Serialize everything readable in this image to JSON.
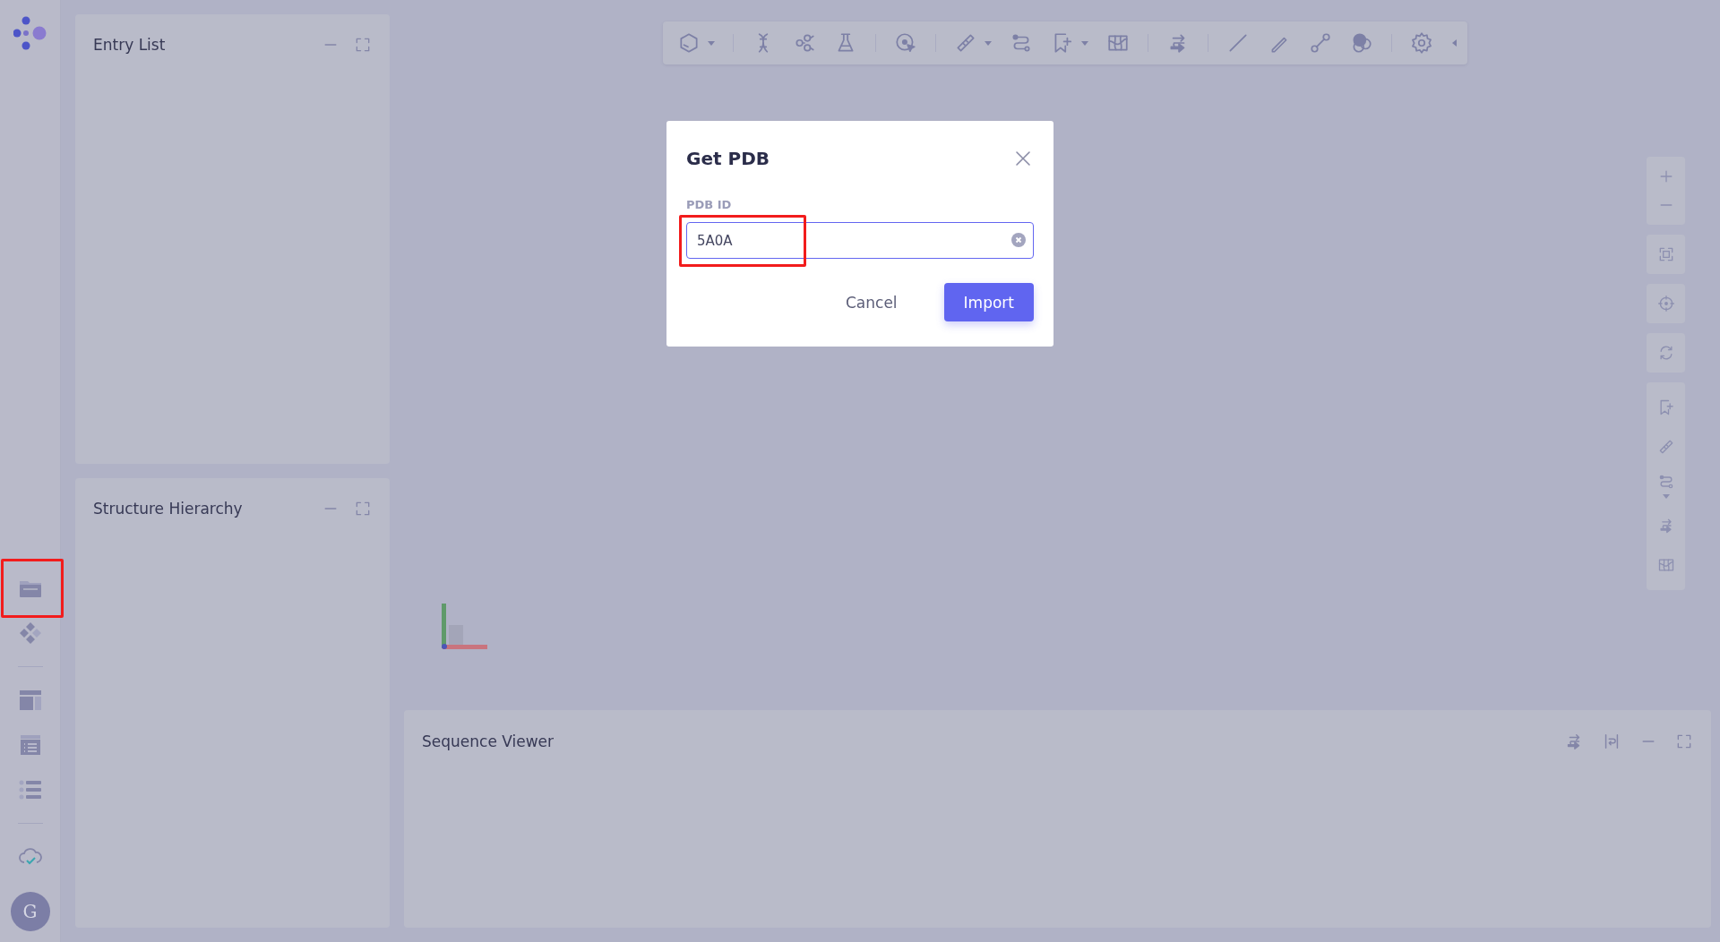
{
  "sidebar": {
    "groups": [
      {
        "items": [
          {
            "kind": "folder",
            "highlighted": true
          },
          {
            "kind": "components",
            "highlighted": false
          }
        ]
      },
      {
        "items": [
          {
            "kind": "layout",
            "highlighted": false
          },
          {
            "kind": "list-card",
            "highlighted": false
          },
          {
            "kind": "list",
            "highlighted": false
          }
        ]
      },
      {
        "items": [
          {
            "kind": "cloud-check",
            "highlighted": false
          }
        ]
      }
    ],
    "avatar": {
      "initial": "G"
    }
  },
  "panels": [
    {
      "title": "Entry List"
    },
    {
      "title": "Structure Hierarchy"
    }
  ],
  "toolbar": {
    "groups": [
      {
        "items": [
          {
            "kind": "hexagon",
            "dropdown": true
          }
        ]
      },
      {
        "items": [
          {
            "kind": "dna",
            "dropdown": false
          },
          {
            "kind": "molecule",
            "dropdown": false
          },
          {
            "kind": "flask",
            "dropdown": false
          }
        ]
      },
      {
        "items": [
          {
            "kind": "target",
            "dropdown": false
          }
        ]
      },
      {
        "items": [
          {
            "kind": "ruler",
            "dropdown": true
          },
          {
            "kind": "path",
            "dropdown": false
          },
          {
            "kind": "bookmark",
            "dropdown": true
          },
          {
            "kind": "map",
            "dropdown": false
          }
        ]
      },
      {
        "items": [
          {
            "kind": "swap",
            "dropdown": false
          }
        ]
      },
      {
        "items": [
          {
            "kind": "line",
            "dropdown": false
          },
          {
            "kind": "pencil",
            "dropdown": false
          },
          {
            "kind": "bond",
            "dropdown": false
          },
          {
            "kind": "spheres",
            "dropdown": false
          }
        ]
      },
      {
        "items": [
          {
            "kind": "gear",
            "dropdown": false
          }
        ]
      }
    ]
  },
  "right_tools": {
    "groups": [
      {
        "items": [
          {
            "kind": "plus",
            "dropdown": false
          },
          {
            "kind": "minus",
            "dropdown": false
          }
        ]
      },
      {
        "items": [
          {
            "kind": "fit",
            "dropdown": false
          }
        ]
      },
      {
        "items": [
          {
            "kind": "center",
            "dropdown": false
          }
        ]
      },
      {
        "items": [
          {
            "kind": "rotate",
            "dropdown": false
          }
        ]
      },
      {
        "items": [
          {
            "kind": "bookmark",
            "dropdown": false
          },
          {
            "kind": "ruler",
            "dropdown": false
          },
          {
            "kind": "path",
            "dropdown": true
          },
          {
            "kind": "swap",
            "dropdown": false
          },
          {
            "kind": "map",
            "dropdown": false
          }
        ]
      }
    ]
  },
  "sequence_viewer": {
    "title": "Sequence Viewer"
  },
  "dialog": {
    "title": "Get PDB",
    "field": {
      "label": "PDB ID",
      "value": "5A0A",
      "highlighted": true
    },
    "buttons": [
      {
        "label": "Cancel",
        "kind": "secondary"
      },
      {
        "label": "Import",
        "kind": "primary"
      }
    ]
  }
}
